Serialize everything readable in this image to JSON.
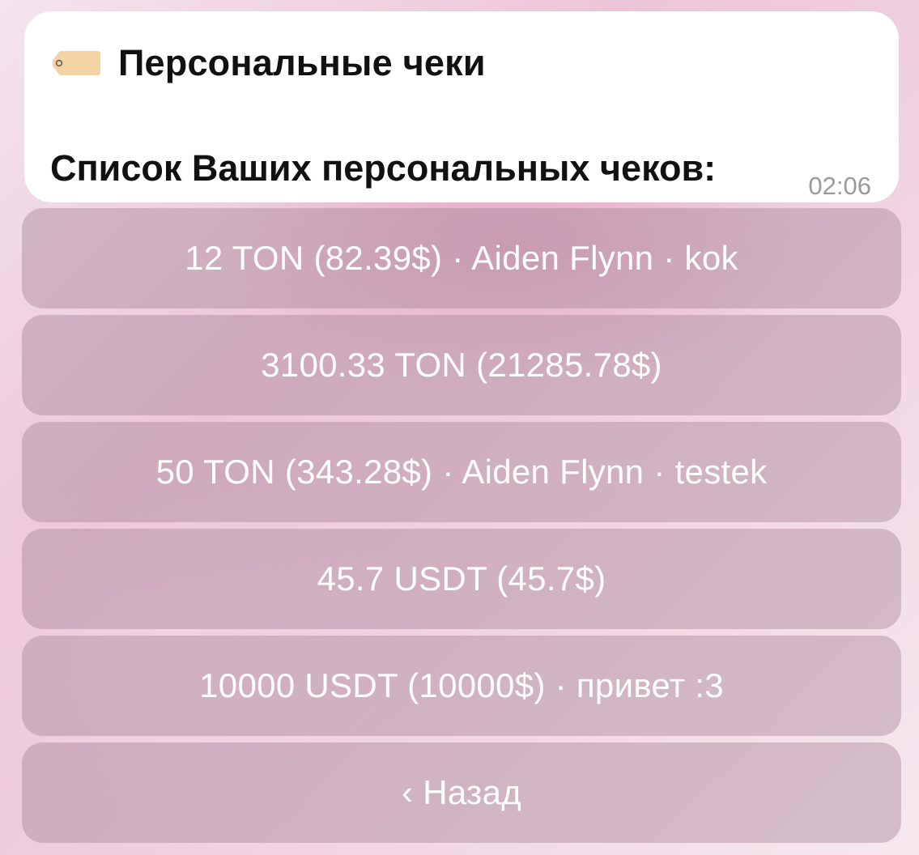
{
  "message": {
    "title": "Персональные чеки",
    "body": "Список Ваших персональных чеков:",
    "time": "02:06",
    "icon": "tag-icon"
  },
  "keyboard": {
    "buttons": [
      {
        "label": "12 TON (82.39$) · Aiden Flynn · kok"
      },
      {
        "label": "3100.33 TON (21285.78$)"
      },
      {
        "label": "50 TON (343.28$) · Aiden Flynn · testek"
      },
      {
        "label": "45.7 USDT (45.7$)"
      },
      {
        "label": "10000 USDT (10000$) · привет :3"
      },
      {
        "label": "‹ Назад"
      }
    ]
  },
  "colors": {
    "tag_fill": "#F3D3A4",
    "button_text": "#FFFFFF",
    "message_bg": "#FFFFFF"
  }
}
